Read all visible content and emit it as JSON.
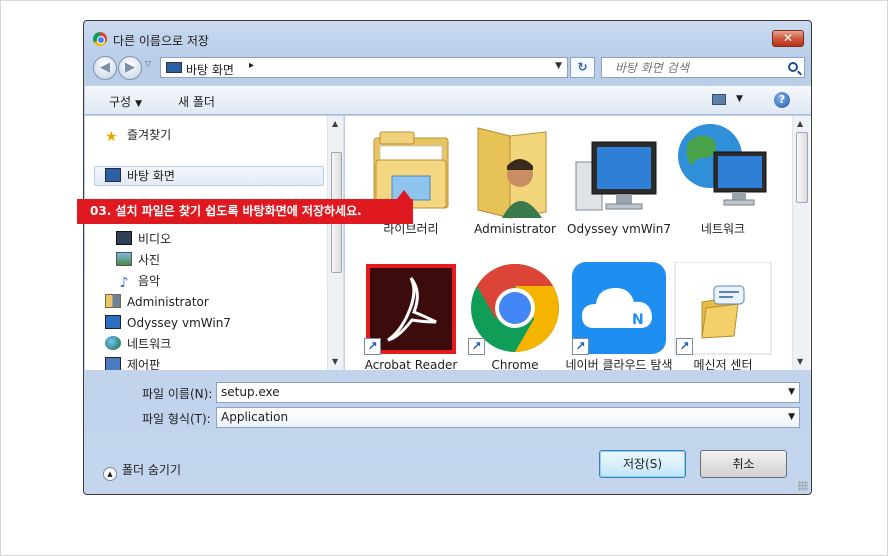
{
  "window": {
    "title": "다른 이름으로 저장",
    "close_label": "✕"
  },
  "address": {
    "location": "바탕 화면",
    "separator": "▸",
    "search_placeholder": "바탕 화면 검색"
  },
  "toolbar": {
    "organize": "구성",
    "new_folder": "새 폴더",
    "help": "?"
  },
  "nav": {
    "items": [
      {
        "label": "즐겨찾기",
        "icon": "star-icon"
      },
      {
        "label": "바탕 화면",
        "icon": "desktop-icon",
        "selected": true
      },
      {
        "label": "비디오",
        "icon": "video-icon"
      },
      {
        "label": "사진",
        "icon": "photo-icon"
      },
      {
        "label": "음악",
        "icon": "music-icon"
      },
      {
        "label": "Administrator",
        "icon": "user-folder-icon"
      },
      {
        "label": "Odyssey vmWin7",
        "icon": "computer-icon"
      },
      {
        "label": "네트워크",
        "icon": "network-icon"
      },
      {
        "label": "제어판",
        "icon": "control-panel-icon"
      }
    ]
  },
  "content": {
    "items": [
      {
        "label": "라이브러리",
        "icon": "libraries-icon"
      },
      {
        "label": "Administrator",
        "icon": "user-folder-icon"
      },
      {
        "label": "Odyssey vmWin7",
        "icon": "computer-icon"
      },
      {
        "label": "네트워크",
        "icon": "network-icon"
      },
      {
        "label": "Acrobat Reader DC",
        "icon": "acrobat-icon",
        "shortcut": true
      },
      {
        "label": "Chrome",
        "icon": "chrome-icon",
        "shortcut": true
      },
      {
        "label": "네이버 클라우드 탐색기",
        "icon": "naver-cloud-icon",
        "shortcut": true
      },
      {
        "label": "메신저 센터",
        "icon": "messenger-center-icon",
        "shortcut": true
      }
    ]
  },
  "form": {
    "filename_label": "파일 이름(N):",
    "filename_value": "setup.exe",
    "filetype_label": "파일 형식(T):",
    "filetype_value": "Application"
  },
  "footer": {
    "hide_folders": "폴더 숨기기",
    "save": "저장(S)",
    "cancel": "취소"
  },
  "callout": {
    "text": "03. 설치 파일은 찾기 쉽도록 바탕화면에 저장하세요."
  },
  "colors": {
    "callout": "#e0181f",
    "title_gradient": "#c9daf0",
    "close_button": "#cf5a3e"
  }
}
